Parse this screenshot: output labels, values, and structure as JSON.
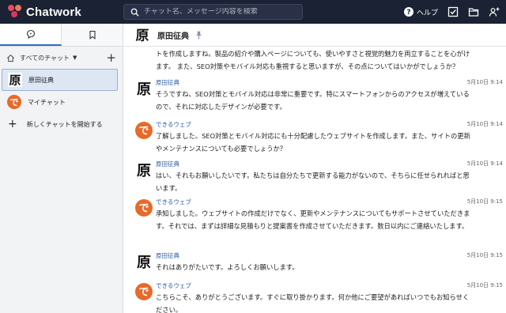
{
  "app": {
    "name": "Chatwork"
  },
  "search": {
    "placeholder": "チャット名、メッセージ内容を検索"
  },
  "topbar": {
    "help_label": "ヘルプ"
  },
  "sidebar": {
    "filter_label": "すべてのチャット",
    "rooms": [
      {
        "name": "原田征典",
        "avatar_char": "原",
        "active": true
      },
      {
        "name": "マイチャット",
        "avatar_char": "で",
        "active": false
      }
    ],
    "new_chat_label": "新しくチャットを開始する"
  },
  "room": {
    "title": "原田征典",
    "avatar_char": "原"
  },
  "messages": [
    {
      "sender": "",
      "time": "",
      "avatar_char": "",
      "text": "トを作成しますね。製品の紹介や購入ページについても、使いやすさと視覚的魅力を両立することを心がけます。 また、SEO対策やモバイル対応も重視すると思いますが、その点についてはいかがでしょうか？"
    },
    {
      "sender": "原田征典",
      "time": "5月10日 9:14",
      "avatar_char": "原",
      "text": "そうですね、SEO対策とモバイル対応は非常に重要です。特にスマートフォンからのアクセスが増えているので、それに対応したデザインが必要です。"
    },
    {
      "sender": "できるウェブ",
      "time": "5月10日 9:14",
      "avatar_char": "で",
      "text": "了解しました。SEO対策とモバイル対応にも十分配慮したウェブサイトを作成します。また、サイトの更新やメンテナンスについても必要でしょうか？"
    },
    {
      "sender": "原田征典",
      "time": "5月10日 9:14",
      "avatar_char": "原",
      "text": "はい、それもお願いしたいです。私たちは自分たちで更新する能力がないので、そちらに任せられればと思います。"
    },
    {
      "sender": "できるウェブ",
      "time": "5月10日 9:15",
      "avatar_char": "で",
      "text": "承知しました。ウェブサイトの作成だけでなく、更新やメンテナンスについてもサポートさせていただきます。それでは、まずは詳細な見積もりと提案書を作成させていただきます。数日以内にご連絡いたします。"
    },
    {
      "sender": "原田征典",
      "time": "5月10日 9:15",
      "avatar_char": "原",
      "text": "それはありがたいです。よろしくお願いします。"
    },
    {
      "sender": "できるウェブ",
      "time": "5月10日 9:15",
      "avatar_char": "で",
      "text": "こちらこそ、ありがとうございます。すぐに取り掛かります。何か他にご要望があればいつでもお知らせください。"
    }
  ],
  "colors": {
    "topbar": "#1b2233",
    "accent": "#2f6fb5",
    "dekiru_avatar": "#e8692a"
  }
}
